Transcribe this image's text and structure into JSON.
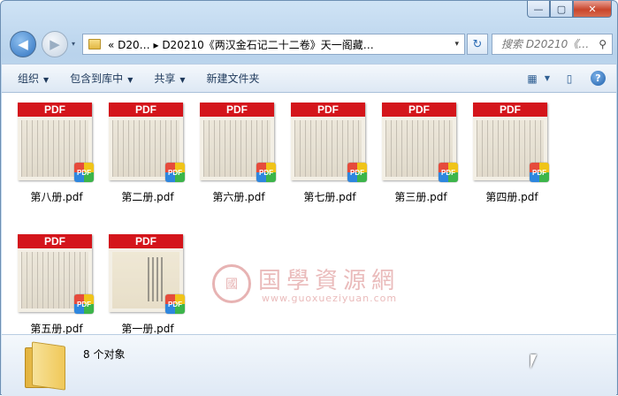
{
  "window": {
    "caption_buttons": [
      "—",
      "▢",
      "✕"
    ]
  },
  "nav": {
    "back": "◀",
    "forward": "▶",
    "dropdown": "▾",
    "address_text": "«  D20…  ▸  D20210《两汉金石记二十二卷》天一阁藏…",
    "address_dropdown": "▾",
    "refresh": "↻",
    "search_placeholder": "搜索 D20210《…",
    "search_icon": "⚲"
  },
  "toolbar": {
    "organize": "组织",
    "include_library": "包含到库中",
    "share": "共享",
    "new_folder": "新建文件夹",
    "dropdown_arrow": "▼",
    "view_icon": "▦",
    "view_dropdown": "▼",
    "pane_icon": "▯",
    "help": "?"
  },
  "files": [
    {
      "name": "第八册.pdf",
      "banner": "PDF",
      "badge": "PDF"
    },
    {
      "name": "第二册.pdf",
      "banner": "PDF",
      "badge": "PDF"
    },
    {
      "name": "第六册.pdf",
      "banner": "PDF",
      "badge": "PDF"
    },
    {
      "name": "第七册.pdf",
      "banner": "PDF",
      "badge": "PDF"
    },
    {
      "name": "第三册.pdf",
      "banner": "PDF",
      "badge": "PDF"
    },
    {
      "name": "第四册.pdf",
      "banner": "PDF",
      "badge": "PDF"
    },
    {
      "name": "第五册.pdf",
      "banner": "PDF",
      "badge": "PDF"
    },
    {
      "name": "第一册.pdf",
      "banner": "PDF",
      "badge": "PDF"
    }
  ],
  "watermark": {
    "logo": "國",
    "title": "国學資源網",
    "url": "www.guoxueziyuan.com"
  },
  "status": {
    "count": "8 个对象"
  },
  "colors": {
    "pdf_banner": "#d4151b",
    "frame": "#b9d3ec"
  }
}
